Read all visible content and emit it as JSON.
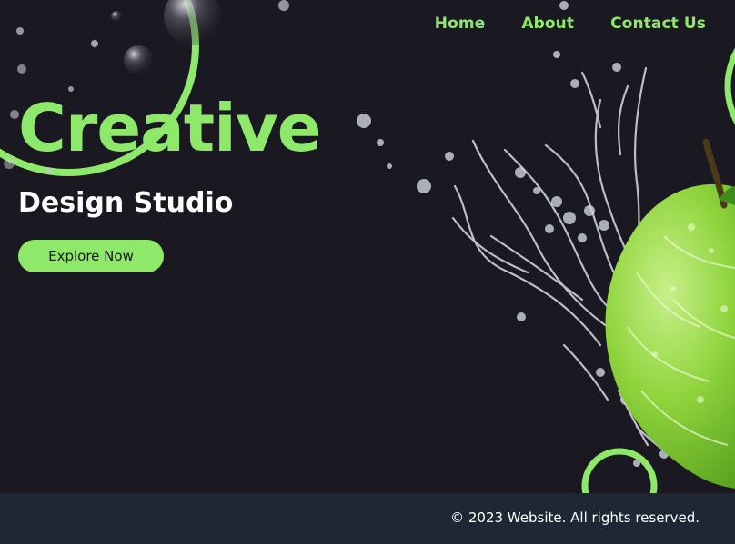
{
  "nav": {
    "items": [
      {
        "label": "Home"
      },
      {
        "label": "About"
      },
      {
        "label": "Contact Us"
      }
    ]
  },
  "hero": {
    "title": "Creative",
    "subtitle": "Design Studio",
    "cta_label": "Explore Now",
    "image": "green-apple-water-splash"
  },
  "footer": {
    "text": "© 2023 Website. All rights reserved."
  },
  "colors": {
    "background": "#1a1820",
    "accent": "#8ee86a",
    "footer_bg": "#1f2735",
    "text_light": "#ffffff"
  }
}
